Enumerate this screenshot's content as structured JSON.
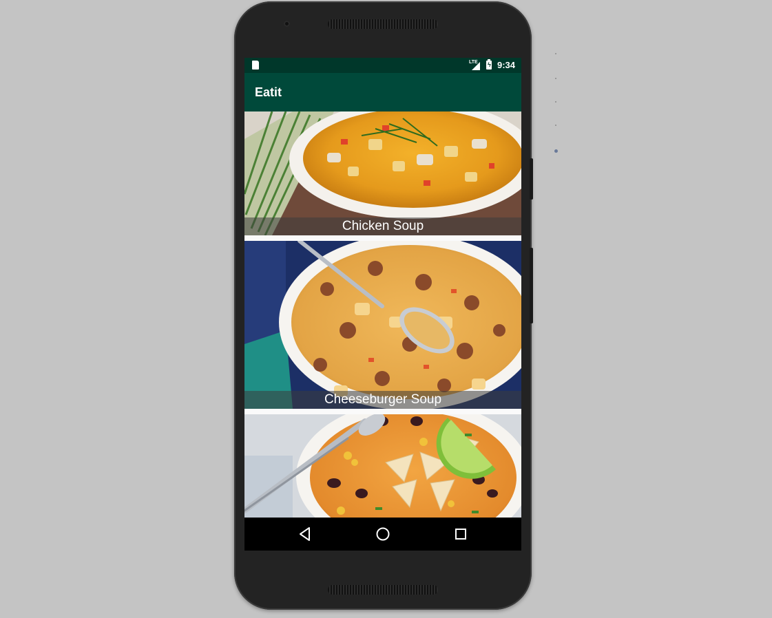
{
  "status_bar": {
    "network_label": "LTE",
    "clock": "9:34",
    "icons": [
      "sd-card-icon",
      "signal-icon",
      "battery-charging-icon"
    ]
  },
  "app_bar": {
    "title": "Eatit"
  },
  "menu": {
    "items": [
      {
        "name": "Chicken Soup",
        "image_icon": "chicken-soup-image"
      },
      {
        "name": "Cheeseburger Soup",
        "image_icon": "cheeseburger-soup-image"
      },
      {
        "name": "",
        "image_icon": "tortilla-soup-image"
      }
    ]
  },
  "nav_bar": {
    "icons": [
      "back-icon",
      "home-icon",
      "recents-icon"
    ]
  },
  "colors": {
    "primary_dark": "#00372a",
    "primary": "#00493a",
    "nav_bar": "#000000",
    "caption_overlay": "#3c3c3c"
  }
}
